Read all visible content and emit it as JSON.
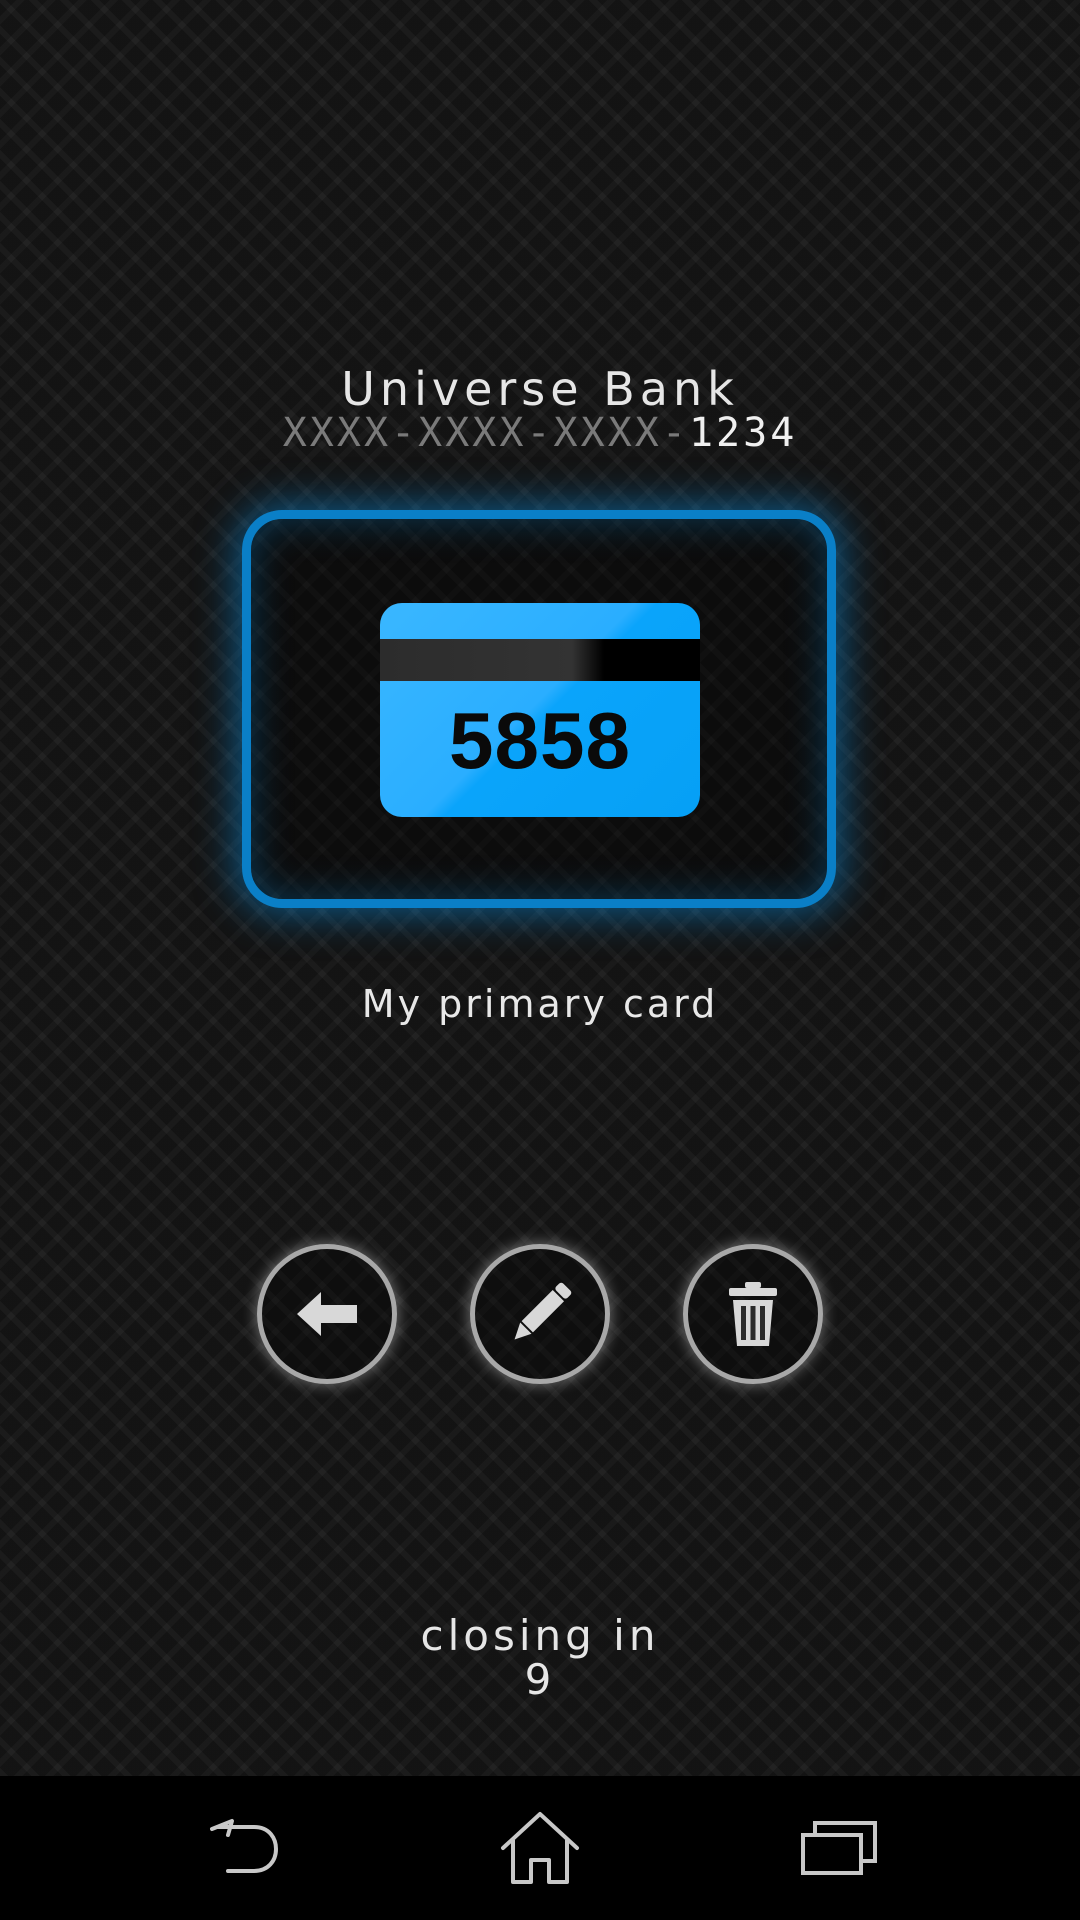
{
  "card": {
    "bank_name": "Universe Bank",
    "number_masked": "XXXX-XXXX-XXXX-",
    "number_last4": "1234",
    "pin": "5858",
    "label": "My primary card"
  },
  "actions": {
    "back_icon": "arrow-left-icon",
    "edit_icon": "pencil-icon",
    "delete_icon": "trash-icon"
  },
  "countdown": {
    "text": "closing in",
    "value": "9"
  },
  "navbar": {
    "back_icon": "back-icon",
    "home_icon": "home-icon",
    "recents_icon": "recents-icon"
  },
  "colors": {
    "accent": "#0a7fc7",
    "card_blue": "#1aabff",
    "text": "#e6e6e6",
    "masked_text": "#7a7a7a"
  }
}
